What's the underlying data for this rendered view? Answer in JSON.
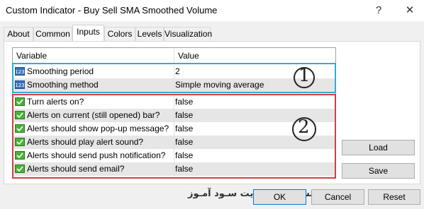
{
  "window": {
    "title": "Custom Indicator - Buy Sell SMA Smoothed Volume",
    "help_glyph": "?",
    "close_glyph": "✕"
  },
  "tabs": [
    "About",
    "Common",
    "Inputs",
    "Colors",
    "Levels",
    "Visualization"
  ],
  "active_tab": "Inputs",
  "table": {
    "headers": {
      "variable": "Variable",
      "value": "Value"
    },
    "rows": [
      {
        "variable": "Smoothing period",
        "value": "2",
        "icon": "numeric-123-icon"
      },
      {
        "variable": "Smoothing method",
        "value": "Simple moving average",
        "icon": "numeric-123-icon"
      },
      {
        "variable": "Turn alerts on?",
        "value": "false",
        "icon": "boolean-check-icon"
      },
      {
        "variable": "Alerts on current (still opened) bar?",
        "value": "false",
        "icon": "boolean-check-icon"
      },
      {
        "variable": "Alerts should show pop-up message?",
        "value": "false",
        "icon": "boolean-check-icon"
      },
      {
        "variable": "Alerts should play alert sound?",
        "value": "false",
        "icon": "boolean-check-icon"
      },
      {
        "variable": "Alerts should send push notification?",
        "value": "false",
        "icon": "boolean-check-icon"
      },
      {
        "variable": "Alerts should send email?",
        "value": "false",
        "icon": "boolean-check-icon"
      }
    ]
  },
  "annotations": {
    "marker_1": "1",
    "marker_2": "2"
  },
  "buttons": {
    "load": "Load",
    "save": "Save",
    "ok": "OK",
    "cancel": "Cancel",
    "reset": "Reset"
  },
  "watermark": "انتشار در وبسایت سـود آمـوز",
  "colors": {
    "group1_border": "#2ab0d9",
    "group2_border": "#d04040",
    "row_alt": "#e6e6e6",
    "ok_border": "#0078d7"
  }
}
